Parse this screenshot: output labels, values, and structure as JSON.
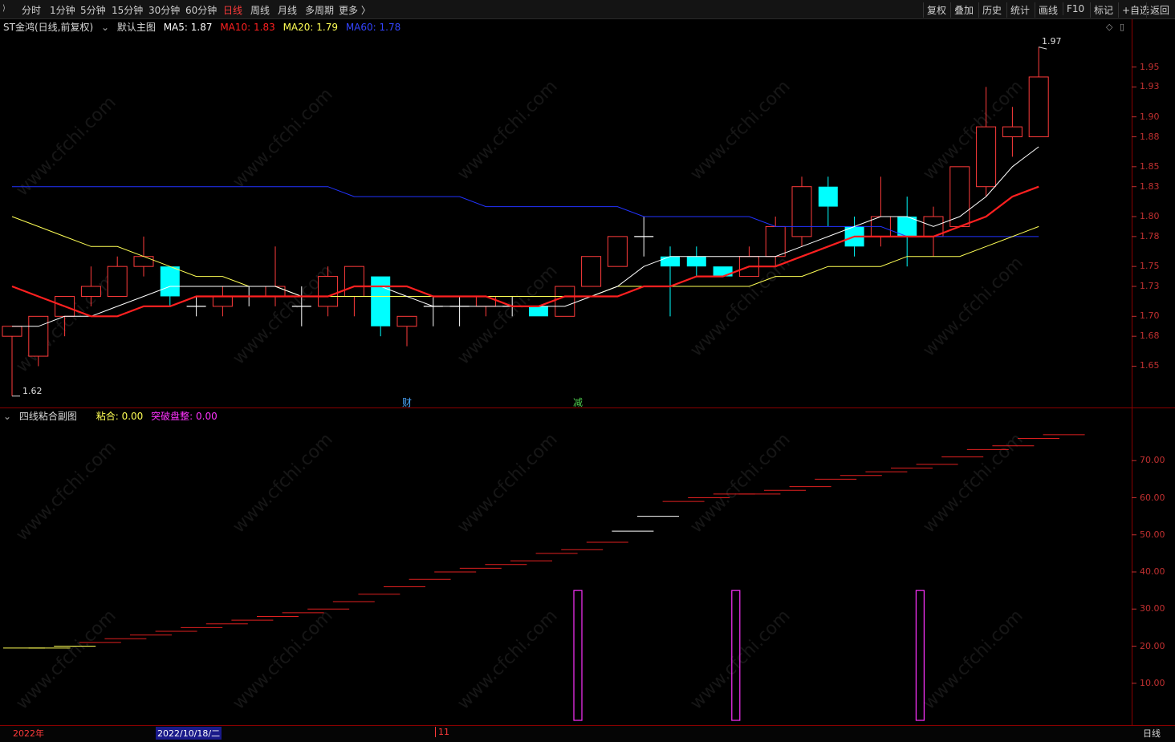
{
  "toolbar": {
    "left": [
      "分时",
      "1分钟",
      "5分钟",
      "15分钟",
      "30分钟",
      "60分钟",
      "日线",
      "周线",
      "月线",
      "多周期",
      "更多 〉"
    ],
    "active": "日线",
    "right": [
      "复权",
      "叠加",
      "历史",
      "统计",
      "画线",
      "F10",
      "标记",
      "+自选",
      "返回"
    ]
  },
  "main_info": {
    "stock": "ST金鸿(日线,前复权)",
    "template": "默认主图",
    "ma5": "MA5: 1.87",
    "ma10": "MA10: 1.83",
    "ma20": "MA20: 1.79",
    "ma60": "MA60: 1.78",
    "high_label": "1.97",
    "low_label": "1.62",
    "marker_cai": "财",
    "marker_jian": "减"
  },
  "sub_info": {
    "title": "四线粘合副图",
    "nianhe": "粘合: 0.00",
    "tupo": "突破盘整: 0.00"
  },
  "bottom": {
    "year": "2022年",
    "date": "2022/10/18/二",
    "month": "11",
    "period": "日线"
  },
  "watermark": "www.cfchi.com",
  "colors": {
    "up": "#ff3b3b",
    "down": "#00ffff",
    "ma5": "#ffffff",
    "ma10": "#ff2020",
    "ma20": "#ffff55",
    "ma60": "#2233ff",
    "axis": "#c03030",
    "magenta": "#ff33ff"
  },
  "chart_data": [
    {
      "type": "candlestick",
      "title": "ST金鸿(日线,前复权)",
      "y_ticks": [
        1.65,
        1.68,
        1.7,
        1.73,
        1.75,
        1.78,
        1.8,
        1.83,
        1.85,
        1.88,
        1.9,
        1.93,
        1.95
      ],
      "ylim": [
        1.615,
        1.985
      ],
      "candles": [
        {
          "o": 1.68,
          "h": 1.69,
          "l": 1.62,
          "c": 1.69
        },
        {
          "o": 1.66,
          "h": 1.7,
          "l": 1.65,
          "c": 1.7
        },
        {
          "o": 1.7,
          "h": 1.72,
          "l": 1.68,
          "c": 1.72
        },
        {
          "o": 1.72,
          "h": 1.75,
          "l": 1.71,
          "c": 1.73
        },
        {
          "o": 1.72,
          "h": 1.76,
          "l": 1.72,
          "c": 1.75
        },
        {
          "o": 1.75,
          "h": 1.78,
          "l": 1.74,
          "c": 1.76
        },
        {
          "o": 1.75,
          "h": 1.75,
          "l": 1.71,
          "c": 1.72
        },
        {
          "o": 1.71,
          "h": 1.72,
          "l": 1.7,
          "c": 1.71
        },
        {
          "o": 1.71,
          "h": 1.73,
          "l": 1.7,
          "c": 1.72
        },
        {
          "o": 1.72,
          "h": 1.73,
          "l": 1.71,
          "c": 1.72
        },
        {
          "o": 1.72,
          "h": 1.77,
          "l": 1.71,
          "c": 1.73
        },
        {
          "o": 1.71,
          "h": 1.73,
          "l": 1.69,
          "c": 1.71
        },
        {
          "o": 1.71,
          "h": 1.75,
          "l": 1.7,
          "c": 1.74
        },
        {
          "o": 1.72,
          "h": 1.75,
          "l": 1.7,
          "c": 1.75
        },
        {
          "o": 1.74,
          "h": 1.74,
          "l": 1.68,
          "c": 1.69
        },
        {
          "o": 1.69,
          "h": 1.7,
          "l": 1.67,
          "c": 1.7
        },
        {
          "o": 1.71,
          "h": 1.72,
          "l": 1.69,
          "c": 1.71
        },
        {
          "o": 1.71,
          "h": 1.72,
          "l": 1.69,
          "c": 1.71
        },
        {
          "o": 1.71,
          "h": 1.72,
          "l": 1.7,
          "c": 1.72
        },
        {
          "o": 1.71,
          "h": 1.72,
          "l": 1.7,
          "c": 1.71
        },
        {
          "o": 1.71,
          "h": 1.71,
          "l": 1.7,
          "c": 1.7
        },
        {
          "o": 1.7,
          "h": 1.73,
          "l": 1.7,
          "c": 1.73
        },
        {
          "o": 1.73,
          "h": 1.76,
          "l": 1.73,
          "c": 1.76
        },
        {
          "o": 1.75,
          "h": 1.78,
          "l": 1.75,
          "c": 1.78
        },
        {
          "o": 1.78,
          "h": 1.8,
          "l": 1.76,
          "c": 1.78
        },
        {
          "o": 1.76,
          "h": 1.77,
          "l": 1.7,
          "c": 1.75
        },
        {
          "o": 1.76,
          "h": 1.77,
          "l": 1.74,
          "c": 1.75
        },
        {
          "o": 1.75,
          "h": 1.75,
          "l": 1.74,
          "c": 1.74
        },
        {
          "o": 1.74,
          "h": 1.77,
          "l": 1.74,
          "c": 1.76
        },
        {
          "o": 1.76,
          "h": 1.8,
          "l": 1.75,
          "c": 1.79
        },
        {
          "o": 1.78,
          "h": 1.84,
          "l": 1.77,
          "c": 1.83
        },
        {
          "o": 1.83,
          "h": 1.84,
          "l": 1.79,
          "c": 1.81
        },
        {
          "o": 1.79,
          "h": 1.8,
          "l": 1.76,
          "c": 1.77
        },
        {
          "o": 1.78,
          "h": 1.84,
          "l": 1.77,
          "c": 1.8
        },
        {
          "o": 1.8,
          "h": 1.82,
          "l": 1.75,
          "c": 1.78
        },
        {
          "o": 1.78,
          "h": 1.81,
          "l": 1.76,
          "c": 1.8
        },
        {
          "o": 1.79,
          "h": 1.85,
          "l": 1.79,
          "c": 1.85
        },
        {
          "o": 1.83,
          "h": 1.93,
          "l": 1.82,
          "c": 1.89
        },
        {
          "o": 1.88,
          "h": 1.91,
          "l": 1.86,
          "c": 1.89
        },
        {
          "o": 1.88,
          "h": 1.97,
          "l": 1.88,
          "c": 1.94
        }
      ],
      "ma5": [
        1.69,
        1.69,
        1.7,
        1.7,
        1.71,
        1.72,
        1.73,
        1.73,
        1.73,
        1.73,
        1.73,
        1.72,
        1.72,
        1.73,
        1.73,
        1.72,
        1.71,
        1.71,
        1.71,
        1.71,
        1.71,
        1.71,
        1.72,
        1.73,
        1.75,
        1.76,
        1.76,
        1.76,
        1.76,
        1.76,
        1.77,
        1.78,
        1.79,
        1.8,
        1.8,
        1.79,
        1.8,
        1.82,
        1.85,
        1.87
      ],
      "ma10": [
        1.73,
        1.72,
        1.71,
        1.7,
        1.7,
        1.71,
        1.71,
        1.72,
        1.72,
        1.72,
        1.72,
        1.72,
        1.72,
        1.73,
        1.73,
        1.73,
        1.72,
        1.72,
        1.72,
        1.71,
        1.71,
        1.72,
        1.72,
        1.72,
        1.73,
        1.73,
        1.74,
        1.74,
        1.75,
        1.75,
        1.76,
        1.77,
        1.78,
        1.78,
        1.78,
        1.78,
        1.79,
        1.8,
        1.82,
        1.83
      ],
      "ma20": [
        1.8,
        1.79,
        1.78,
        1.77,
        1.77,
        1.76,
        1.75,
        1.74,
        1.74,
        1.73,
        1.73,
        1.72,
        1.72,
        1.72,
        1.72,
        1.72,
        1.72,
        1.72,
        1.72,
        1.72,
        1.72,
        1.72,
        1.72,
        1.73,
        1.73,
        1.73,
        1.73,
        1.73,
        1.73,
        1.74,
        1.74,
        1.75,
        1.75,
        1.75,
        1.76,
        1.76,
        1.76,
        1.77,
        1.78,
        1.79
      ],
      "ma60": [
        1.83,
        1.83,
        1.83,
        1.83,
        1.83,
        1.83,
        1.83,
        1.83,
        1.83,
        1.83,
        1.83,
        1.83,
        1.83,
        1.82,
        1.82,
        1.82,
        1.82,
        1.82,
        1.81,
        1.81,
        1.81,
        1.81,
        1.81,
        1.81,
        1.8,
        1.8,
        1.8,
        1.8,
        1.8,
        1.79,
        1.79,
        1.79,
        1.79,
        1.79,
        1.78,
        1.78,
        1.78,
        1.78,
        1.78,
        1.78
      ]
    },
    {
      "type": "bar",
      "title": "四线粘合副图",
      "y_ticks": [
        10,
        20,
        30,
        40,
        50,
        60,
        70
      ],
      "ylim": [
        0,
        80
      ],
      "steps": [
        19.5,
        19.5,
        20,
        21,
        22,
        23,
        24,
        25,
        26,
        27,
        28,
        29,
        30,
        32,
        34,
        36,
        38,
        40,
        41,
        42,
        43,
        45,
        46,
        48,
        51,
        55,
        59,
        60,
        61,
        61,
        62,
        63,
        65,
        66,
        67,
        68,
        69,
        71,
        73,
        74,
        76,
        77
      ],
      "pulse_bars": [
        {
          "index": 20,
          "value": 35
        },
        {
          "index": 26,
          "value": 35
        },
        {
          "index": 33,
          "value": 35
        }
      ]
    }
  ]
}
